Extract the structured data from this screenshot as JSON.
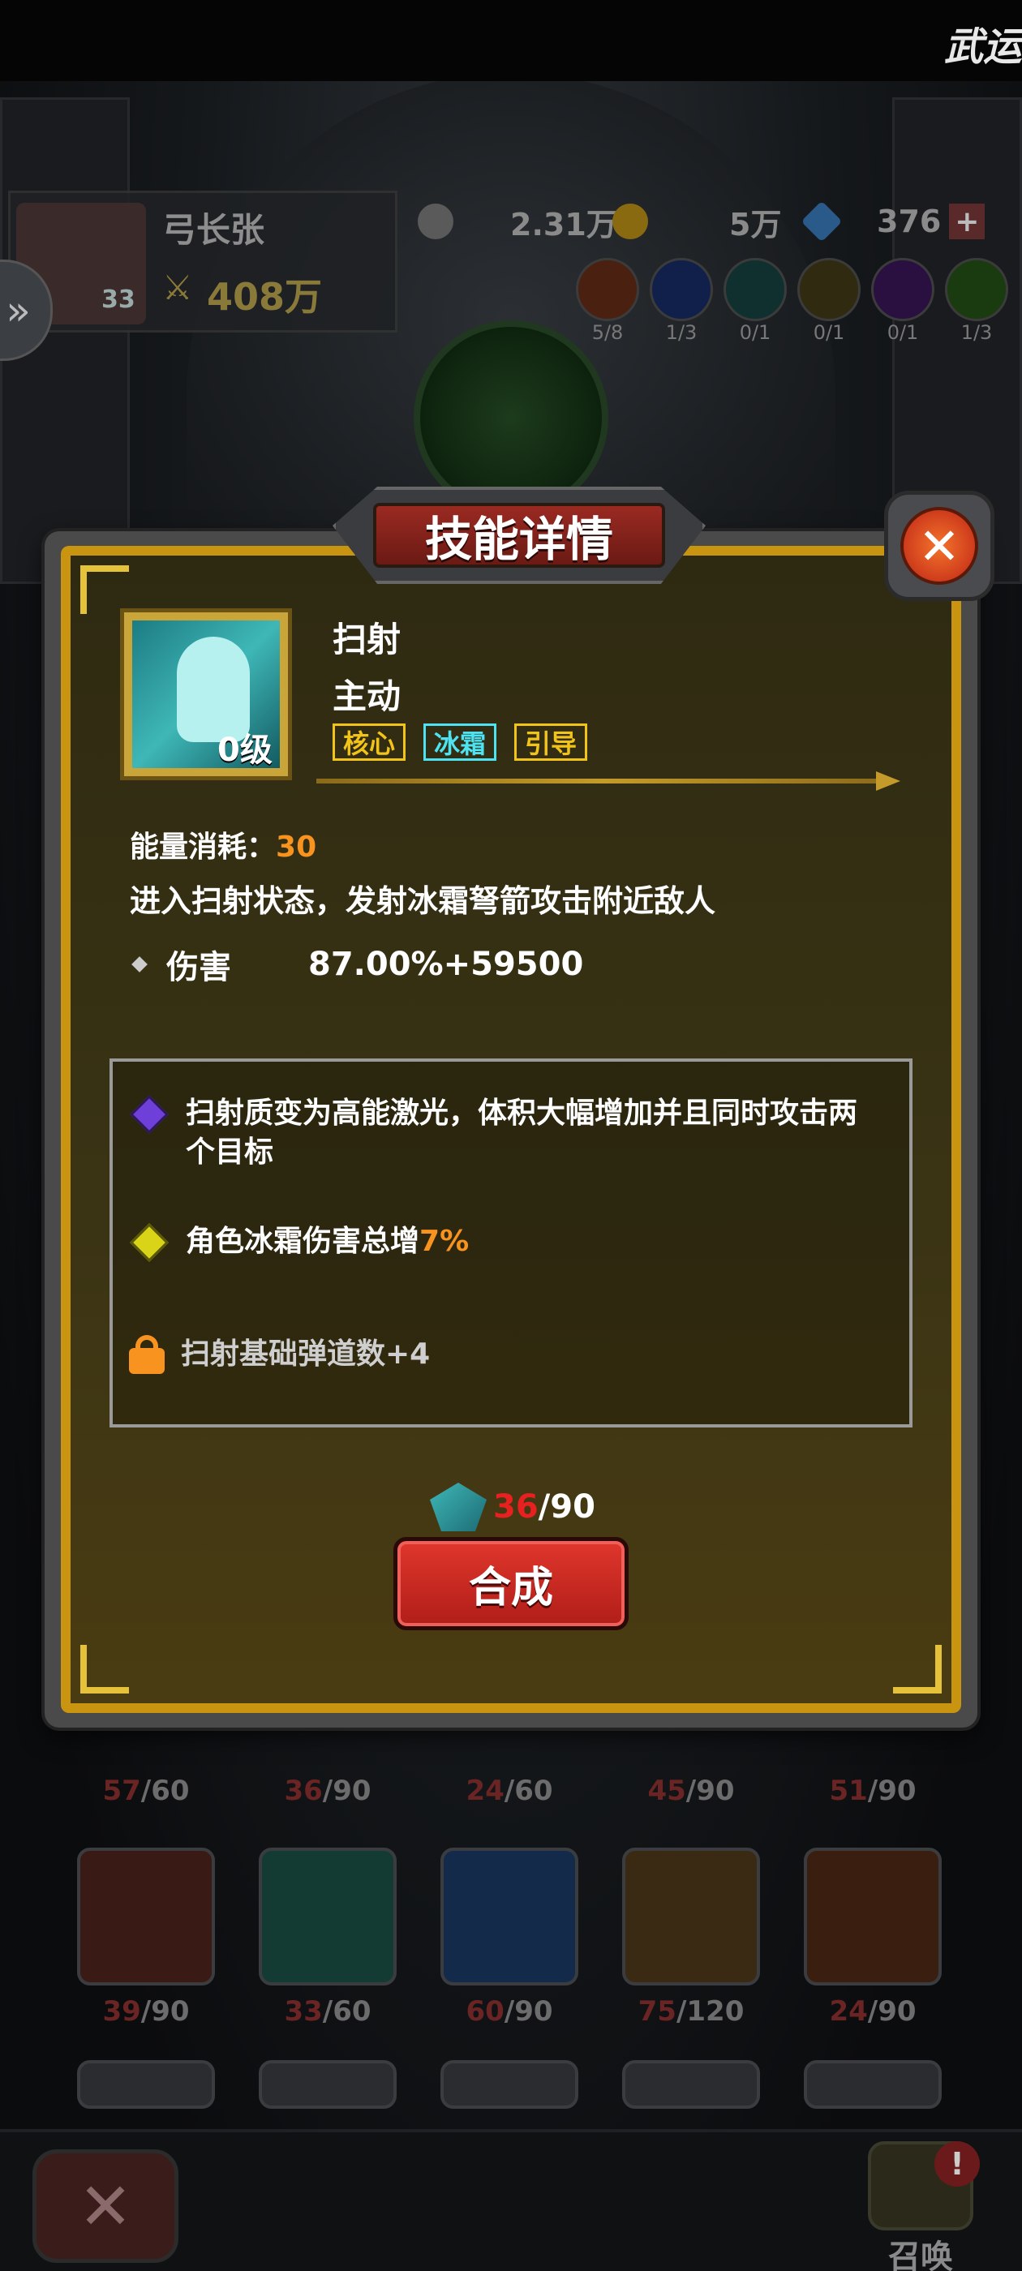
{
  "header": {
    "title_partial": "武运"
  },
  "player": {
    "name": "弓长张",
    "level": "33",
    "power": "408万"
  },
  "currencies": [
    {
      "name": "silver",
      "value": "2.31万",
      "color": "#8a8a8a"
    },
    {
      "name": "gold",
      "value": "5万",
      "color": "#c9a020"
    },
    {
      "name": "diamond",
      "value": "376",
      "color": "#3a8ac9"
    }
  ],
  "elements": [
    {
      "name": "fire",
      "count": "5/8",
      "color": "#8a3a1a"
    },
    {
      "name": "ice",
      "count": "1/3",
      "color": "#1a3a8a"
    },
    {
      "name": "wind",
      "count": "0/1",
      "color": "#1a5a5a"
    },
    {
      "name": "earth",
      "count": "0/1",
      "color": "#5a4a1a"
    },
    {
      "name": "shadow",
      "count": "0/1",
      "color": "#4a1a6a"
    },
    {
      "name": "nature",
      "count": "1/3",
      "color": "#2a5a1a"
    }
  ],
  "dialog": {
    "title": "技能详情",
    "close_label": "✕",
    "skill": {
      "name": "扫射",
      "type": "主动",
      "level": "0级",
      "tags": [
        "核心",
        "冰霜",
        "引导"
      ]
    },
    "energy_label": "能量消耗：",
    "energy_value": "30",
    "description": "进入扫射状态，发射冰霜弩箭攻击附近敌人",
    "damage_label": "伤害",
    "damage_value": "87.00%+59500",
    "upgrades": [
      {
        "icon": "purple-gem-icon",
        "text": "扫射质变为高能激光，体积大幅增加并且同时攻击两个目标"
      },
      {
        "icon": "yellow-gem-icon",
        "text_prefix": "角色冰霜伤害总增",
        "highlight": "7%"
      },
      {
        "icon": "lock-icon",
        "text": "扫射基础弹道数+4"
      }
    ],
    "fragments_current": "36",
    "fragments_total": "/90",
    "synth_label": "合成"
  },
  "inventory": {
    "rows": [
      [
        {
          "cur": "57",
          "total": "/60"
        },
        {
          "cur": "36",
          "total": "/90"
        },
        {
          "cur": "24",
          "total": "/60"
        },
        {
          "cur": "45",
          "total": "/90"
        },
        {
          "cur": "51",
          "total": "/90"
        }
      ],
      [
        {
          "cur": "39",
          "total": "/90"
        },
        {
          "cur": "33",
          "total": "/60"
        },
        {
          "cur": "60",
          "total": "/90"
        },
        {
          "cur": "75",
          "total": "/120"
        },
        {
          "cur": "24",
          "total": "/90"
        }
      ]
    ]
  },
  "bottom": {
    "close_label": "✕",
    "summon_label": "召唤",
    "badge": "!"
  }
}
